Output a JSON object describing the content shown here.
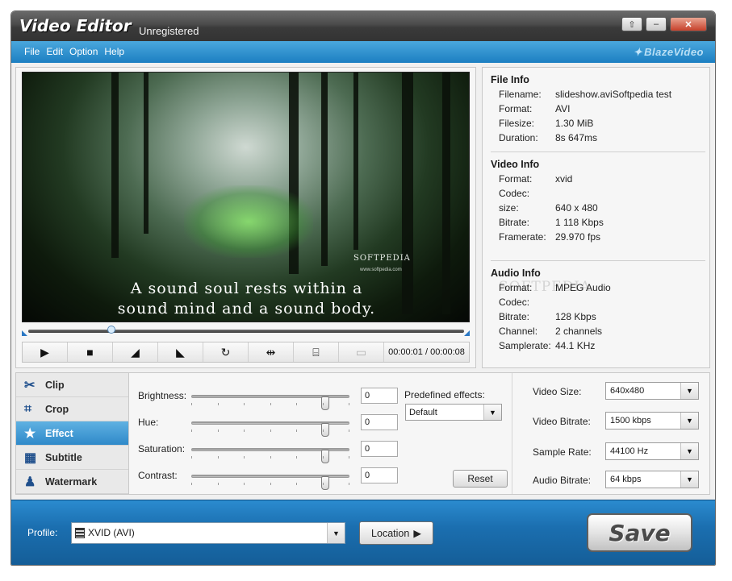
{
  "window": {
    "title": "Video Editor",
    "subtitle": "Unregistered"
  },
  "titlebar_buttons": {
    "restore": "⇧",
    "minimize": "–",
    "close": "✕"
  },
  "menu": {
    "items": [
      "File",
      "Edit",
      "Option",
      "Help"
    ],
    "brand": "BlazeVideo"
  },
  "preview": {
    "watermark": "SOFTPEDIA",
    "watermark_url": "www.softpedia.com",
    "caption_line1": "A sound soul rests within a",
    "caption_line2": "sound mind and a sound body.",
    "progress": 0.19,
    "timecode": "00:00:01 / 00:00:08"
  },
  "controls": {
    "play": "▶",
    "stop": "■",
    "mark_in": "◢",
    "mark_out": "◣",
    "rotate": "↻",
    "flip": "⇹",
    "snapshot": "⌸",
    "fullscreen": "▭"
  },
  "file_info": {
    "heading": "File Info",
    "rows": [
      {
        "key": "Filename:",
        "value": "slideshow.aviSoftpedia test"
      },
      {
        "key": "Format:",
        "value": "AVI"
      },
      {
        "key": "Filesize:",
        "value": "1.30 MiB"
      },
      {
        "key": "Duration:",
        "value": "8s 647ms"
      }
    ]
  },
  "video_info": {
    "heading": "Video Info",
    "rows": [
      {
        "key": "Format:",
        "value": "xvid"
      },
      {
        "key": "Codec:",
        "value": ""
      },
      {
        "key": "size:",
        "value": "640 x 480"
      },
      {
        "key": "Bitrate:",
        "value": "1 118 Kbps"
      },
      {
        "key": "Framerate:",
        "value": "29.970 fps"
      }
    ]
  },
  "audio_info": {
    "heading": "Audio Info",
    "watermark": "SOFTPEDIA",
    "rows": [
      {
        "key": "Format:",
        "value": "MPEG Audio"
      },
      {
        "key": "Codec:",
        "value": ""
      },
      {
        "key": "Bitrate:",
        "value": "128 Kbps"
      },
      {
        "key": "Channel:",
        "value": "2 channels"
      },
      {
        "key": "Samplerate:",
        "value": "44.1 KHz"
      }
    ]
  },
  "tabs": [
    {
      "label": "Clip",
      "icon": "✂"
    },
    {
      "label": "Crop",
      "icon": "⌗"
    },
    {
      "label": "Effect",
      "icon": "★"
    },
    {
      "label": "Subtitle",
      "icon": "▦"
    },
    {
      "label": "Watermark",
      "icon": "♟"
    }
  ],
  "active_tab": "Effect",
  "effects": {
    "sliders": [
      {
        "label": "Brightness:",
        "value": "0"
      },
      {
        "label": "Hue:",
        "value": "0"
      },
      {
        "label": "Saturation:",
        "value": "0"
      },
      {
        "label": "Contrast:",
        "value": "0"
      }
    ],
    "predefined_label": "Predefined effects:",
    "predefined_value": "Default",
    "reset_label": "Reset"
  },
  "output": [
    {
      "label": "Video Size:",
      "value": "640x480"
    },
    {
      "label": "Video Bitrate:",
      "value": "1500 kbps"
    },
    {
      "label": "Sample Rate:",
      "value": "44100 Hz"
    },
    {
      "label": "Audio Bitrate:",
      "value": "64 kbps"
    }
  ],
  "footer": {
    "profile_label": "Profile:",
    "profile_value": "XVID (AVI)",
    "location_label": "Location",
    "save_label": "Save"
  },
  "colors": {
    "accent_blue": "#1c7fc2",
    "title_bar": "#3a3a3a",
    "footer_blue": "#1b6fb0"
  }
}
